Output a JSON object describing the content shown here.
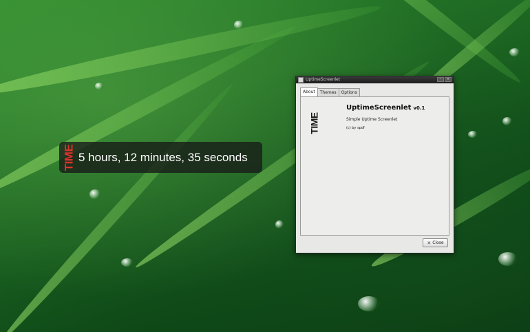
{
  "widget": {
    "logo_text": "TIME",
    "uptime": "5 hours, 12 minutes, 35 seconds"
  },
  "window": {
    "title": "UptimeScreenlet",
    "tabs": [
      {
        "label": "About"
      },
      {
        "label": "Themes"
      },
      {
        "label": "Options"
      }
    ],
    "about": {
      "logo_text": "TIME",
      "app_name": "UptimeScreenlet",
      "version": "v0.1",
      "description": "Simple Uptime Screenlet",
      "copyright": "(c) by spdf"
    },
    "close_label": "Close",
    "icons": {
      "title": "window-icon",
      "close": "close-icon"
    }
  },
  "colors": {
    "time_logo_red": "#e0302a",
    "widget_bg": "#191e19",
    "window_bg": "#e8e8e7"
  }
}
